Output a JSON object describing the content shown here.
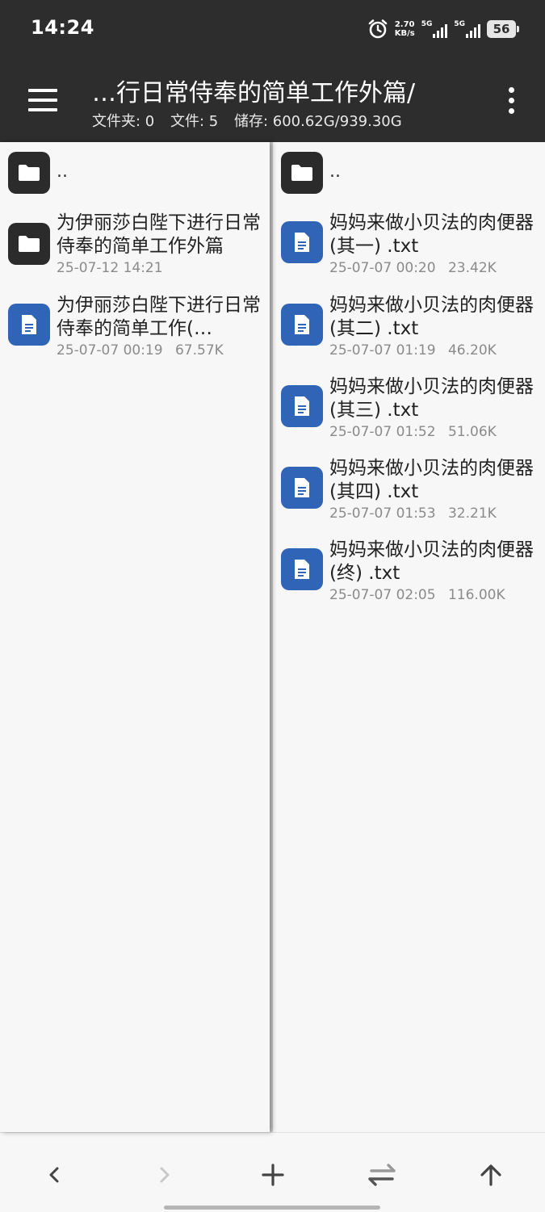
{
  "status_bar": {
    "time": "14:24",
    "speed_value": "2.70",
    "speed_unit": "KB/s",
    "sim1_label": "5G",
    "sim2_label": "5G",
    "battery": "56",
    "icons": [
      "alarm-icon",
      "signal-icon",
      "battery-icon"
    ]
  },
  "toolbar": {
    "title": "…行日常侍奉的简单工作外篇/",
    "folders": "文件夹: 0",
    "files": "文件: 5",
    "storage": "储存: 600.62G/939.30G"
  },
  "left_pane": {
    "up_label": "..",
    "items": [
      {
        "type": "folder",
        "name": "为伊丽莎白陛下进行日常侍奉的简单工作外篇",
        "date": "25-07-12 14:21",
        "size": ""
      },
      {
        "type": "file",
        "name": "为伊丽莎白陛下进行日常侍奉的简单工作(…",
        "date": "25-07-07 00:19",
        "size": "67.57K"
      }
    ]
  },
  "right_pane": {
    "up_label": "..",
    "items": [
      {
        "type": "file",
        "name": "妈妈来做小贝法的肉便器 (其一) .txt",
        "date": "25-07-07 00:20",
        "size": "23.42K"
      },
      {
        "type": "file",
        "name": "妈妈来做小贝法的肉便器 (其二) .txt",
        "date": "25-07-07 01:19",
        "size": "46.20K"
      },
      {
        "type": "file",
        "name": "妈妈来做小贝法的肉便器 (其三) .txt",
        "date": "25-07-07 01:52",
        "size": "51.06K"
      },
      {
        "type": "file",
        "name": "妈妈来做小贝法的肉便器 (其四) .txt",
        "date": "25-07-07 01:53",
        "size": "32.21K"
      },
      {
        "type": "file",
        "name": "妈妈来做小贝法的肉便器 (终) .txt",
        "date": "25-07-07 02:05",
        "size": "116.00K"
      }
    ]
  },
  "bottom_bar": {
    "buttons": [
      "back-icon",
      "forward-icon",
      "add-icon",
      "swap-icon",
      "up-icon"
    ]
  },
  "colors": {
    "header_bg": "#2d2d2d",
    "folder_icon_bg": "#2b2b2b",
    "file_icon_bg": "#2f64b7",
    "meta_text": "#8b8b8b"
  }
}
